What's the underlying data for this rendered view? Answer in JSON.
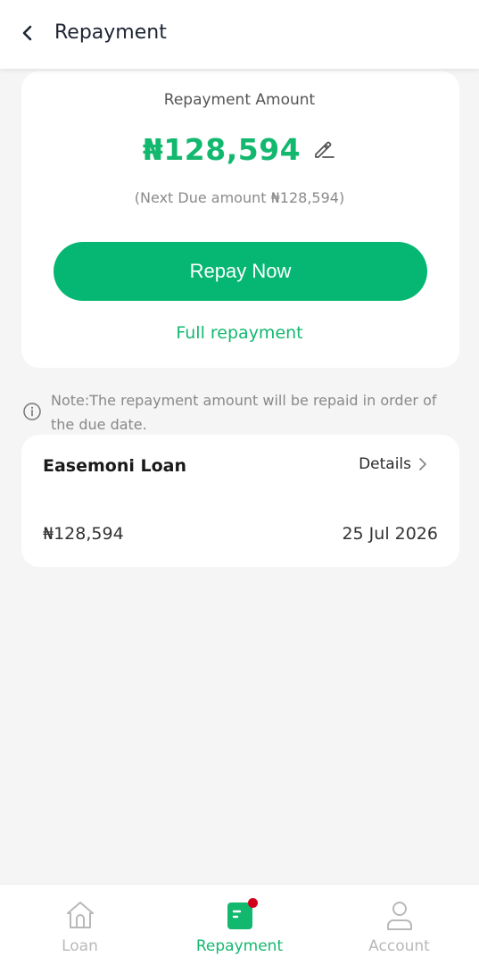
{
  "header": {
    "title": "Repayment"
  },
  "repayment": {
    "label": "Repayment Amount",
    "amount": "₦128,594",
    "next_due_prefix": "(Next Due amount ",
    "next_due_amount": "₦128,594",
    "next_due_suffix": ")",
    "repay_button": "Repay Now",
    "full_repayment_link": "Full repayment"
  },
  "note": {
    "text": "Note:The repayment amount will be repaid in order of the due date."
  },
  "loan": {
    "name": "Easemoni Loan",
    "details_label": "Details",
    "amount": "₦128,594",
    "due_date": "25 Jul 2026"
  },
  "tabbar": {
    "items": [
      {
        "label": "Loan",
        "icon": "home-icon",
        "active": false
      },
      {
        "label": "Repayment",
        "icon": "repayment-icon",
        "active": true
      },
      {
        "label": "Account",
        "icon": "person-icon",
        "active": false
      }
    ]
  },
  "colors": {
    "accent": "#13b86f",
    "button": "#05b772",
    "badge": "#d0021b"
  }
}
